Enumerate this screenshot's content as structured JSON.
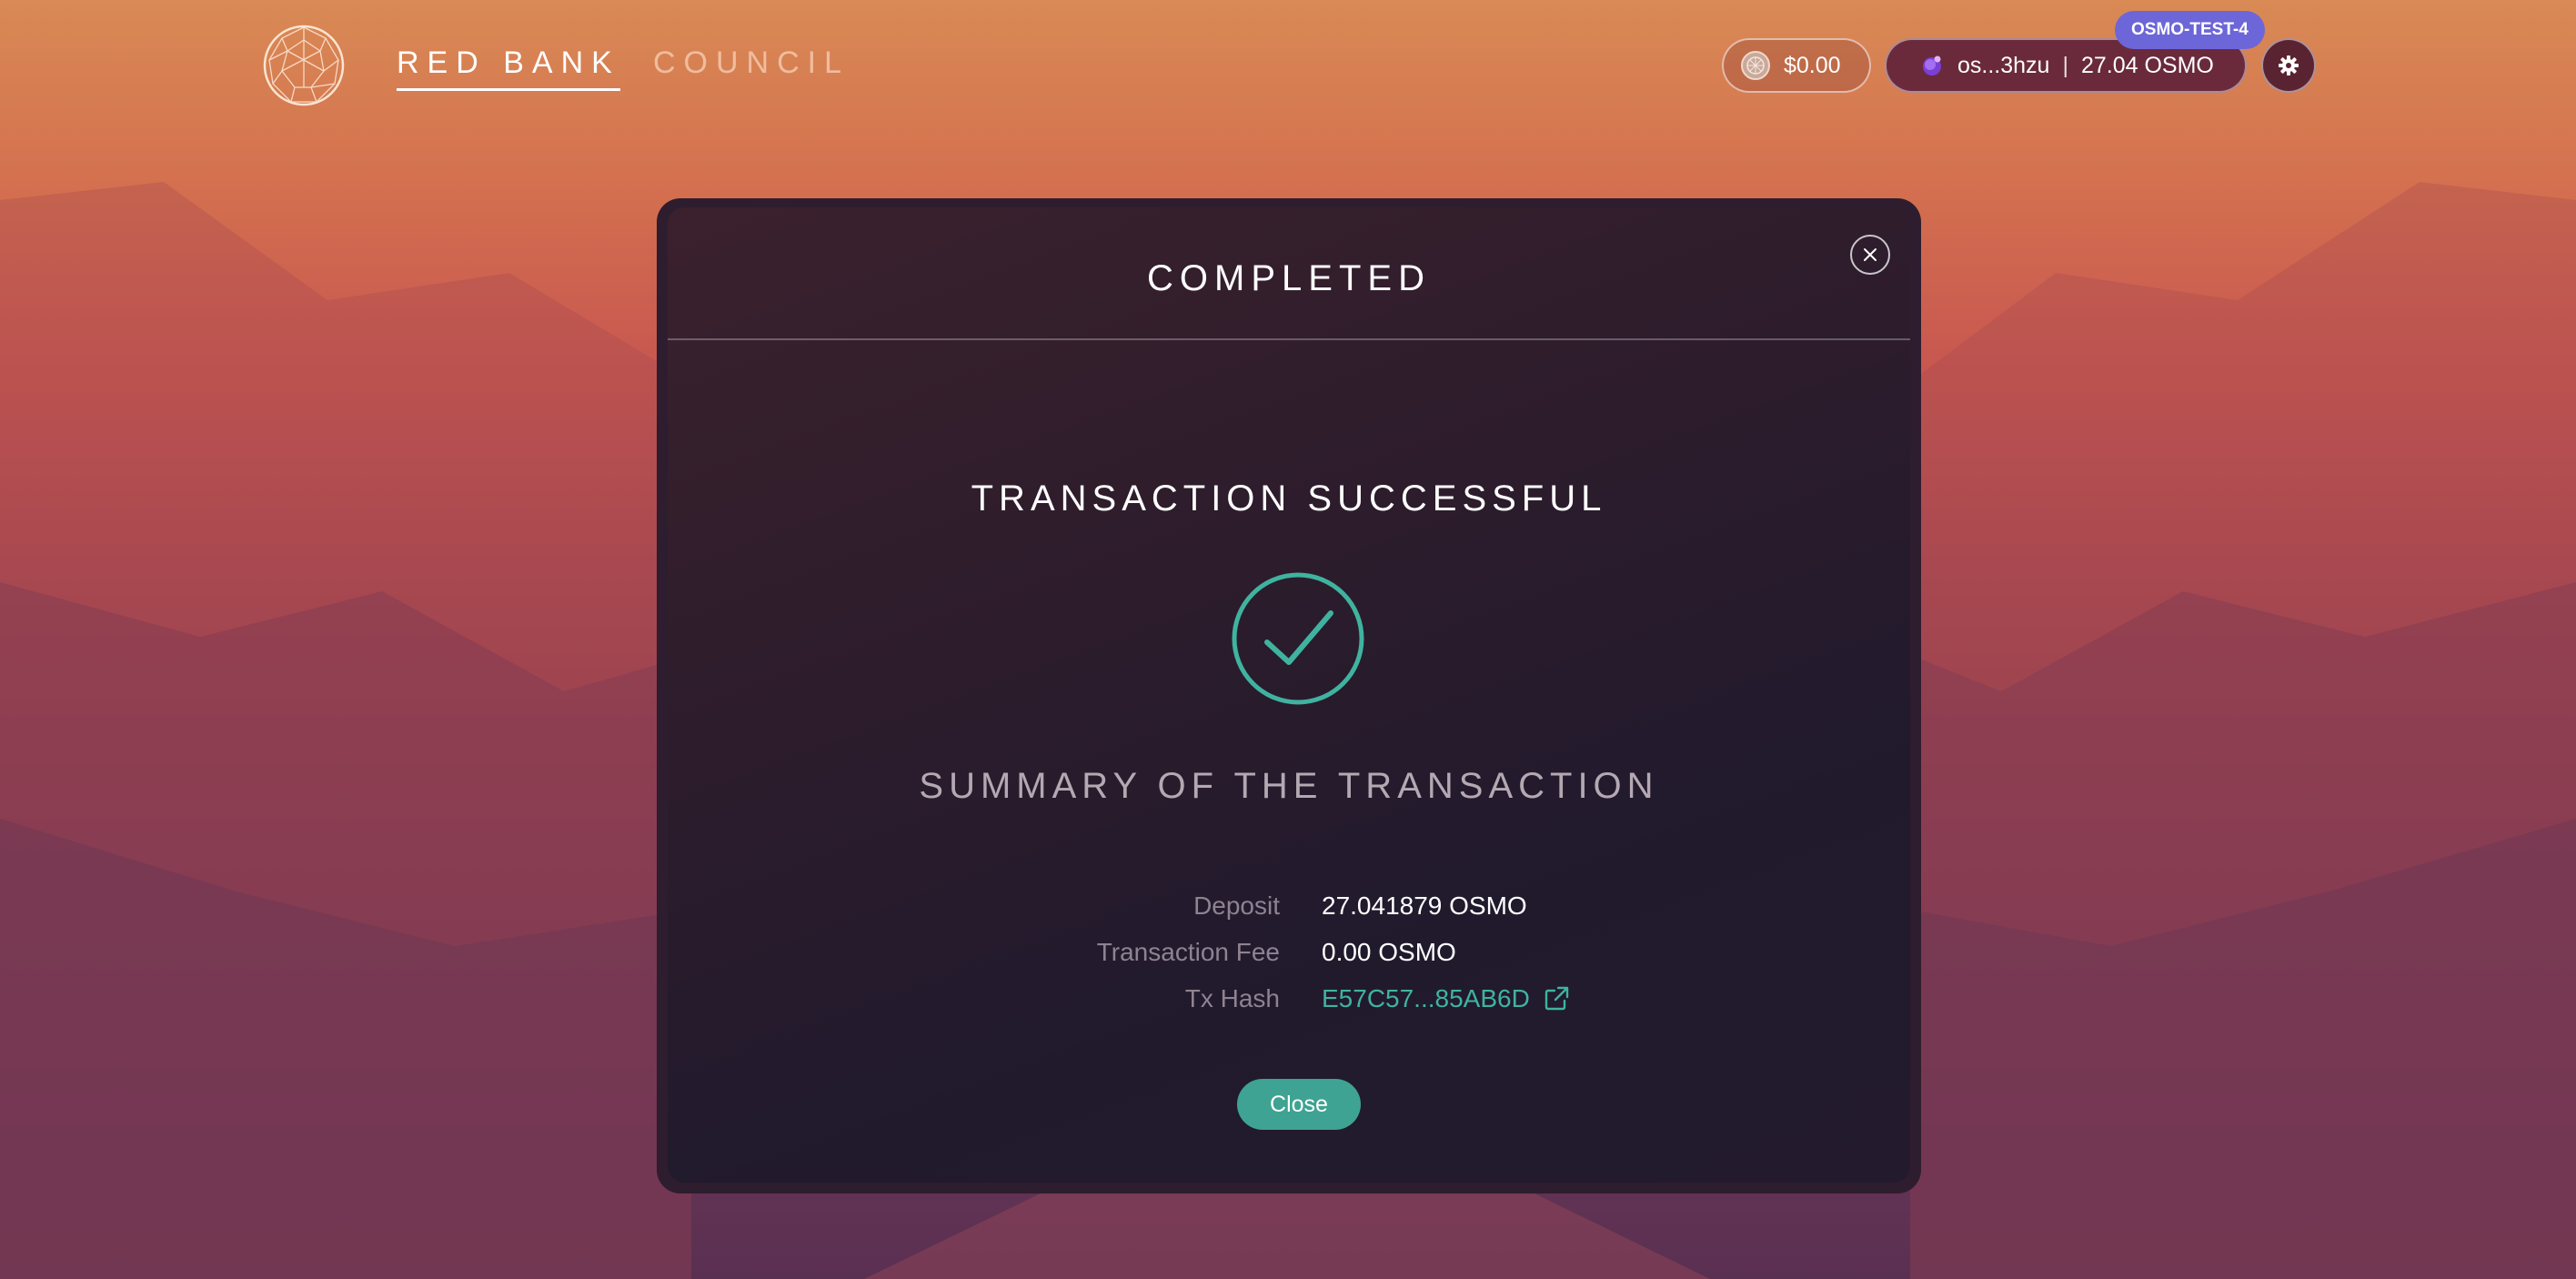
{
  "header": {
    "nav": [
      {
        "label": "RED BANK",
        "active": true
      },
      {
        "label": "COUNCIL",
        "active": false
      }
    ],
    "balance": "$0.00",
    "wallet": {
      "address": "os...3hzu",
      "separator": "|",
      "amount": "27.04 OSMO"
    },
    "network_badge": "OSMO-TEST-4",
    "icons": {
      "logo": "globe-logo",
      "balance": "coin-icon",
      "wallet": "osmo-token-icon",
      "settings": "gear-icon"
    }
  },
  "modal": {
    "title": "COMPLETED",
    "success_title": "TRANSACTION SUCCESSFUL",
    "summary_title": "SUMMARY OF THE TRANSACTION",
    "details": [
      {
        "label": "Deposit",
        "value": "27.041879 OSMO"
      },
      {
        "label": "Transaction Fee",
        "value": "0.00 OSMO"
      },
      {
        "label": "Tx Hash",
        "value": "E57C57...85AB6D"
      }
    ],
    "close_button": "Close",
    "icons": {
      "close": "close-icon",
      "success": "check-circle-icon",
      "external": "external-link-icon"
    }
  },
  "colors": {
    "accent": "#3fb3a0",
    "button": "#3ea392",
    "badge": "#6d66d8",
    "modal_bg": "#2e1d2e"
  }
}
